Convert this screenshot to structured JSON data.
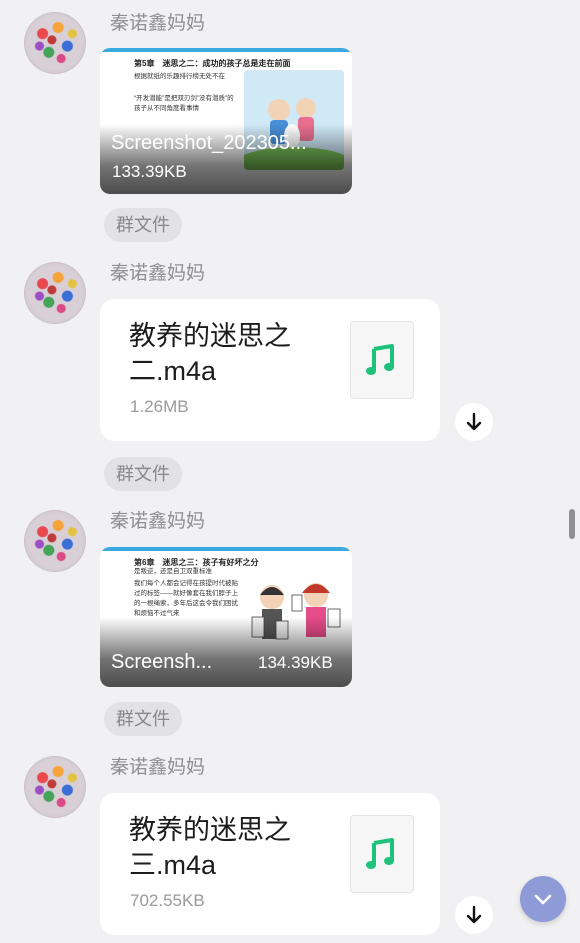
{
  "colors": {
    "background": "#f1f1f3",
    "music_icon": "#1ec27a",
    "fab": "#8e9bd6"
  },
  "messages": [
    {
      "sender": "秦诺鑫妈妈",
      "type": "image",
      "file_name": "Screenshot_202305...",
      "file_size": "133.39KB",
      "slide": {
        "title": "第5章　迷思之二：成功的孩子总是走在前面",
        "bullets": [
          "根据就纸的乐趣排行榜无处不在",
          "“开发潜能”是把双刃剑”没有潜质”的孩子从不同角度看事情"
        ]
      },
      "tag": "群文件"
    },
    {
      "sender": "秦诺鑫妈妈",
      "type": "file",
      "file_name": "教养的迷思之二.m4a",
      "file_size": "1.26MB",
      "icon": "music-note-icon",
      "tag": "群文件"
    },
    {
      "sender": "秦诺鑫妈妈",
      "type": "image",
      "file_name": "Screensh...",
      "file_size": "134.39KB",
      "slide": {
        "title": "第6章　迷思之三：孩子有好坏之分",
        "bullets": [
          "是叛逆，还是自卫双重标准",
          "我们每个人都会记得在孩提时代被贴过的标签——就好像套在我们脖子上的一根绳索，多年后这会令我们困扰和烦恼不过气来"
        ]
      },
      "tag": "群文件"
    },
    {
      "sender": "秦诺鑫妈妈",
      "type": "file",
      "file_name": "教养的迷思之三.m4a",
      "file_size": "702.55KB",
      "icon": "music-note-icon"
    }
  ]
}
